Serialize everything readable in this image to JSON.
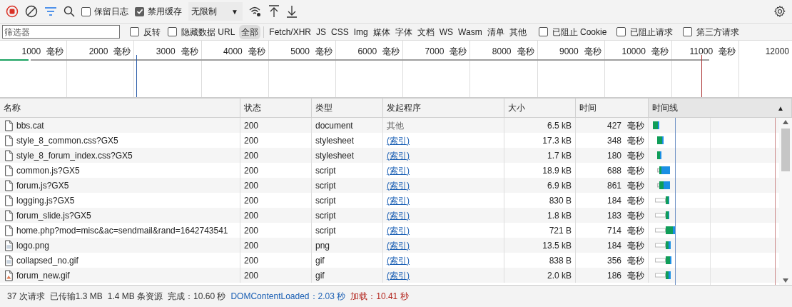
{
  "toolbar": {
    "preserve_log": {
      "label": "保留日志",
      "checked": false
    },
    "disable_cache": {
      "label": "禁用缓存",
      "checked": true
    },
    "throttling": {
      "value": "无限制",
      "caret": "▼"
    }
  },
  "filter_bar": {
    "placeholder": "筛选器",
    "invert": {
      "label": "反转",
      "checked": false
    },
    "hide_data_urls": {
      "label": "隐藏数据 URL",
      "checked": false
    },
    "types": [
      {
        "label": "全部",
        "selected": true
      },
      {
        "label": "Fetch/XHR",
        "selected": false
      },
      {
        "label": "JS",
        "selected": false
      },
      {
        "label": "CSS",
        "selected": false
      },
      {
        "label": "Img",
        "selected": false
      },
      {
        "label": "媒体",
        "selected": false
      },
      {
        "label": "字体",
        "selected": false
      },
      {
        "label": "文档",
        "selected": false
      },
      {
        "label": "WS",
        "selected": false
      },
      {
        "label": "Wasm",
        "selected": false
      },
      {
        "label": "清单",
        "selected": false
      },
      {
        "label": "其他",
        "selected": false
      }
    ],
    "options": [
      {
        "label": "已阻止 Cookie",
        "checked": false
      },
      {
        "label": "已阻止请求",
        "checked": false
      },
      {
        "label": "第三方请求",
        "checked": false
      }
    ]
  },
  "overview": {
    "ticks": [
      {
        "value": "1000",
        "unit": "毫秒"
      },
      {
        "value": "2000",
        "unit": "毫秒"
      },
      {
        "value": "3000",
        "unit": "毫秒"
      },
      {
        "value": "4000",
        "unit": "毫秒"
      },
      {
        "value": "5000",
        "unit": "毫秒"
      },
      {
        "value": "6000",
        "unit": "毫秒"
      },
      {
        "value": "7000",
        "unit": "毫秒"
      },
      {
        "value": "8000",
        "unit": "毫秒"
      },
      {
        "value": "9000",
        "unit": "毫秒"
      },
      {
        "value": "10000",
        "unit": "毫秒"
      },
      {
        "value": "11000",
        "unit": "毫秒"
      },
      {
        "value": "12000"
      }
    ]
  },
  "table": {
    "columns": [
      {
        "label": "名称"
      },
      {
        "label": "状态"
      },
      {
        "label": "类型"
      },
      {
        "label": "发起程序"
      },
      {
        "label": "大小"
      },
      {
        "label": "时间"
      },
      {
        "label": "时间线",
        "sort_indicator": "▲"
      }
    ],
    "rows": [
      {
        "kind": "document",
        "name": "bbs.cat",
        "status": "200",
        "type": "document",
        "initiator": "其他",
        "initiator_link": false,
        "size": "6.5 kB",
        "time": "427",
        "time_unit": "毫秒"
      },
      {
        "kind": "document",
        "name": "style_8_common.css?GX5",
        "status": "200",
        "type": "stylesheet",
        "initiator": "(索引)",
        "initiator_link": true,
        "size": "17.3 kB",
        "time": "348",
        "time_unit": "毫秒"
      },
      {
        "kind": "document",
        "name": "style_8_forum_index.css?GX5",
        "status": "200",
        "type": "stylesheet",
        "initiator": "(索引)",
        "initiator_link": true,
        "size": "1.7 kB",
        "time": "180",
        "time_unit": "毫秒"
      },
      {
        "kind": "document",
        "name": "common.js?GX5",
        "status": "200",
        "type": "script",
        "initiator": "(索引)",
        "initiator_link": true,
        "size": "18.9 kB",
        "time": "688",
        "time_unit": "毫秒"
      },
      {
        "kind": "document",
        "name": "forum.js?GX5",
        "status": "200",
        "type": "script",
        "initiator": "(索引)",
        "initiator_link": true,
        "size": "6.9 kB",
        "time": "861",
        "time_unit": "毫秒"
      },
      {
        "kind": "document",
        "name": "logging.js?GX5",
        "status": "200",
        "type": "script",
        "initiator": "(索引)",
        "initiator_link": true,
        "size": "830 B",
        "time": "184",
        "time_unit": "毫秒"
      },
      {
        "kind": "document",
        "name": "forum_slide.js?GX5",
        "status": "200",
        "type": "script",
        "initiator": "(索引)",
        "initiator_link": true,
        "size": "1.8 kB",
        "time": "183",
        "time_unit": "毫秒"
      },
      {
        "kind": "document",
        "name": "home.php?mod=misc&ac=sendmail&rand=1642743541",
        "status": "200",
        "type": "script",
        "initiator": "(索引)",
        "initiator_link": true,
        "size": "721 B",
        "time": "714",
        "time_unit": "毫秒"
      },
      {
        "kind": "image",
        "name": "logo.png",
        "status": "200",
        "type": "png",
        "initiator": "(索引)",
        "initiator_link": true,
        "size": "13.5 kB",
        "time": "184",
        "time_unit": "毫秒"
      },
      {
        "kind": "image",
        "name": "collapsed_no.gif",
        "status": "200",
        "type": "gif",
        "initiator": "(索引)",
        "initiator_link": true,
        "size": "838 B",
        "time": "356",
        "time_unit": "毫秒"
      },
      {
        "kind": "gif",
        "name": "forum_new.gif",
        "status": "200",
        "type": "gif",
        "initiator": "(索引)",
        "initiator_link": true,
        "size": "2.0 kB",
        "time": "186",
        "time_unit": "毫秒"
      }
    ]
  },
  "status_bar": [
    {
      "text": "37 次请求",
      "color": "#333333"
    },
    {
      "text": "已传输1.3 MB",
      "color": "#333333"
    },
    {
      "text": "1.4 MB 条资源",
      "color": "#333333"
    },
    {
      "text": "完成：10.60 秒",
      "color": "#333333"
    },
    {
      "text": "DOMContentLoaded：2.03 秒",
      "color": "#1a5fb4"
    },
    {
      "text": "加载：10.41 秒",
      "color": "#b3261e"
    }
  ]
}
